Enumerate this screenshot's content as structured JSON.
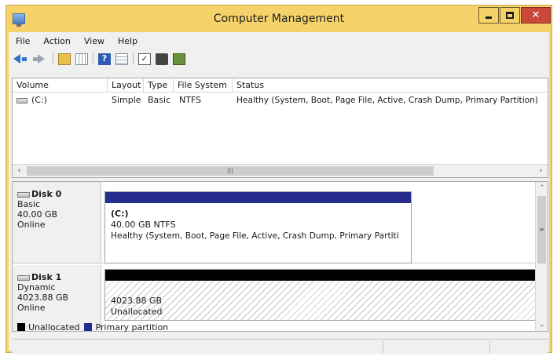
{
  "window": {
    "title": "Computer Management",
    "accent_color": "#f6d36a"
  },
  "menu": [
    "File",
    "Action",
    "View",
    "Help"
  ],
  "toolbar": {
    "icons": [
      "back-arrow-icon",
      "forward-arrow-icon",
      "up-folder-icon",
      "show-hide-tree-icon",
      "help-icon",
      "list-view-icon",
      "properties-icon",
      "key-icon",
      "disk-icon"
    ]
  },
  "volume_list": {
    "columns": [
      "Volume",
      "Layout",
      "Type",
      "File System",
      "Status"
    ],
    "rows": [
      {
        "volume": "(C:)",
        "layout": "Simple",
        "type": "Basic",
        "file_system": "NTFS",
        "status": "Healthy (System, Boot, Page File, Active, Crash Dump, Primary Partition)"
      }
    ]
  },
  "disks": [
    {
      "name": "Disk 0",
      "kind": "Basic",
      "size": "40.00 GB",
      "state": "Online",
      "partition": {
        "label": "(C:)",
        "size_fs": "40.00 GB NTFS",
        "status": "Healthy (System, Boot, Page File, Active, Crash Dump, Primary Partiti"
      }
    },
    {
      "name": "Disk 1",
      "kind": "Dynamic",
      "size": "4023.88 GB",
      "state": "Online",
      "partition": {
        "size": "4023.88 GB",
        "status": "Unallocated"
      }
    }
  ],
  "legend": [
    {
      "label": "Unallocated",
      "color": "#000000"
    },
    {
      "label": "Primary partition",
      "color": "#262d8c"
    }
  ]
}
